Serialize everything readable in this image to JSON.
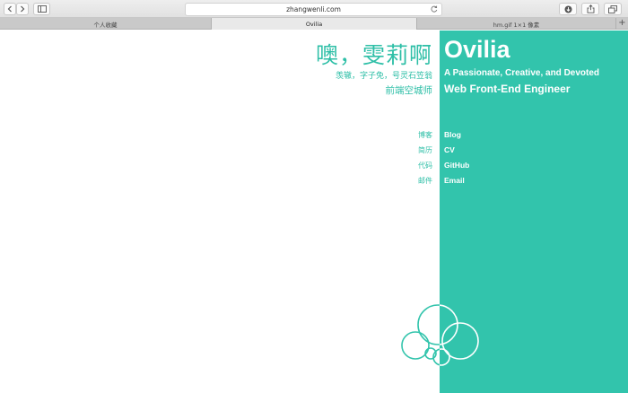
{
  "browser": {
    "address": "zhangwenli.com",
    "tabs": [
      {
        "label": "个人收藏"
      },
      {
        "label": "Ovilia"
      },
      {
        "label": "hm.gif 1×1 像素"
      }
    ],
    "new_tab_label": "+"
  },
  "page": {
    "title_cn": "噢，雯莉啊",
    "title_en": "Ovilia",
    "subtitle1_cn": "羡辙，字子免，号灵石笠翁",
    "subtitle1_en": "A Passionate, Creative, and Devoted",
    "subtitle2_cn": "前端空城师",
    "subtitle2_en": "Web Front-End Engineer",
    "nav": [
      {
        "cn": "博客",
        "en": "Blog"
      },
      {
        "cn": "简历",
        "en": "CV"
      },
      {
        "cn": "代码",
        "en": "GitHub"
      },
      {
        "cn": "邮件",
        "en": "Email"
      }
    ]
  },
  "colors": {
    "accent": "#32c4ac",
    "accent_text": "#2ebfa7",
    "background": "#ffffff"
  },
  "icons": {
    "back": "chevron-left-icon",
    "forward": "chevron-right-icon",
    "sidebar": "sidebar-icon",
    "reload": "reload-icon",
    "download": "download-icon",
    "share": "share-icon",
    "tabs": "tabs-overview-icon",
    "logo": "cloud-logo-icon"
  }
}
